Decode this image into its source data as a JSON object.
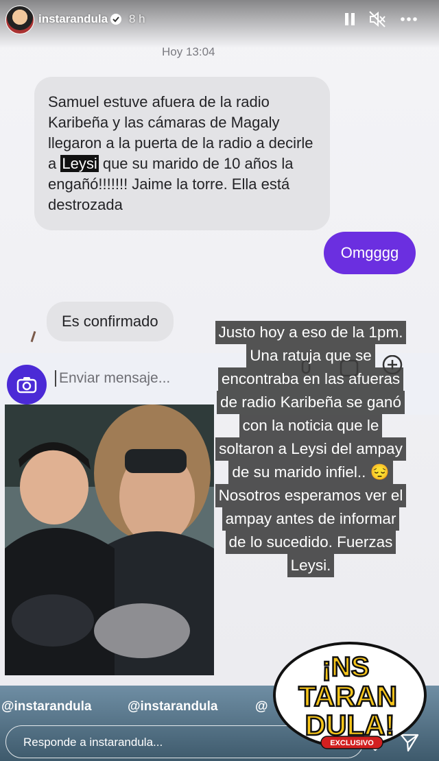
{
  "header": {
    "username": "instarandula",
    "time_ago": "8 h",
    "icons": [
      "pause-icon",
      "mute-icon",
      "more-icon"
    ]
  },
  "chat": {
    "timestamp": "Hoy 13:04",
    "message_main_before": "Samuel estuve afuera de la radio Karibeña y las cámaras de Magaly llegaron a la puerta de la radio a decirle a ",
    "message_main_highlight": "Leysi",
    "message_main_after": " que su marido de 10 años la engañó!!!!!!! Jaime la torre. Ella está destrozada",
    "message_out": "Omgggg",
    "message_confirm": "Es confirmado",
    "composer_placeholder": "Enviar mensaje..."
  },
  "caption": {
    "lines": [
      "Justo hoy a eso de la 1pm.",
      "Una ratuja que se",
      "encontraba en las afueras",
      "de radio Karibeña se ganó",
      "con la noticia que le",
      "soltaron a Leysi del ampay",
      "de su marido infiel.. 😔",
      "Nosotros esperamos ver el",
      "ampay  antes de informar",
      "de lo sucedido. Fuerzas",
      "Leysi."
    ]
  },
  "tags": [
    "@instarandula",
    "@instarandula",
    "@"
  ],
  "logo": {
    "line1": "¡NS",
    "line2": "TARAN",
    "line3": "DULA!",
    "badge": "EXCLUSIVO"
  },
  "reply": {
    "placeholder": "Responde a instarandula..."
  },
  "colors": {
    "accent_purple": "#6b2fe0",
    "camera_blue": "#4b2ad6",
    "logo_yellow": "#f7c51a"
  }
}
